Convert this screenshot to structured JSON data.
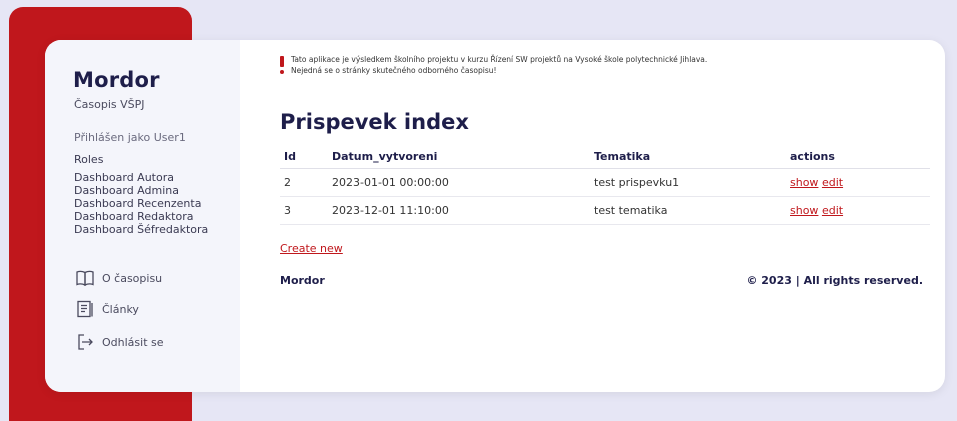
{
  "sidebar": {
    "brand": "Mordor",
    "subtitle": "Časopis VŠPJ",
    "logged_in": "Přihlášen jako User1",
    "links": [
      "Roles",
      "Dashboard Autora",
      "Dashboard Admina",
      "Dashboard Recenzenta",
      "Dashboard Redaktora",
      "Dashboard Šéfredaktora"
    ],
    "icon_items": [
      {
        "label": "O časopisu",
        "icon": "book-icon"
      },
      {
        "label": "Články",
        "icon": "article-icon"
      },
      {
        "label": "Odhlásit se",
        "icon": "logout-icon"
      }
    ]
  },
  "notice": {
    "line1": "Tato aplikace je výsledkem školního projektu v kurzu Řízení SW projektů na Vysoké škole polytechnické Jihlava.",
    "line2": "Nejedná se o stránky skutečného odborného časopisu!"
  },
  "page": {
    "title": "Prispevek index"
  },
  "table": {
    "headers": [
      "Id",
      "Datum_vytvoreni",
      "Tematika",
      "actions"
    ],
    "rows": [
      {
        "id": "2",
        "date": "2023-01-01 00:00:00",
        "topic": "test prispevku1",
        "show": "show",
        "edit": "edit"
      },
      {
        "id": "3",
        "date": "2023-12-01 11:10:00",
        "topic": "test tematika",
        "show": "show",
        "edit": "edit"
      }
    ]
  },
  "create_new": "Create new",
  "footer": {
    "brand": "Mordor",
    "copyright": "© 2023 | All rights reserved."
  },
  "colors": {
    "accent": "#c0171c",
    "brand_text": "#1e1e4a",
    "background": "#e6e6f5"
  }
}
